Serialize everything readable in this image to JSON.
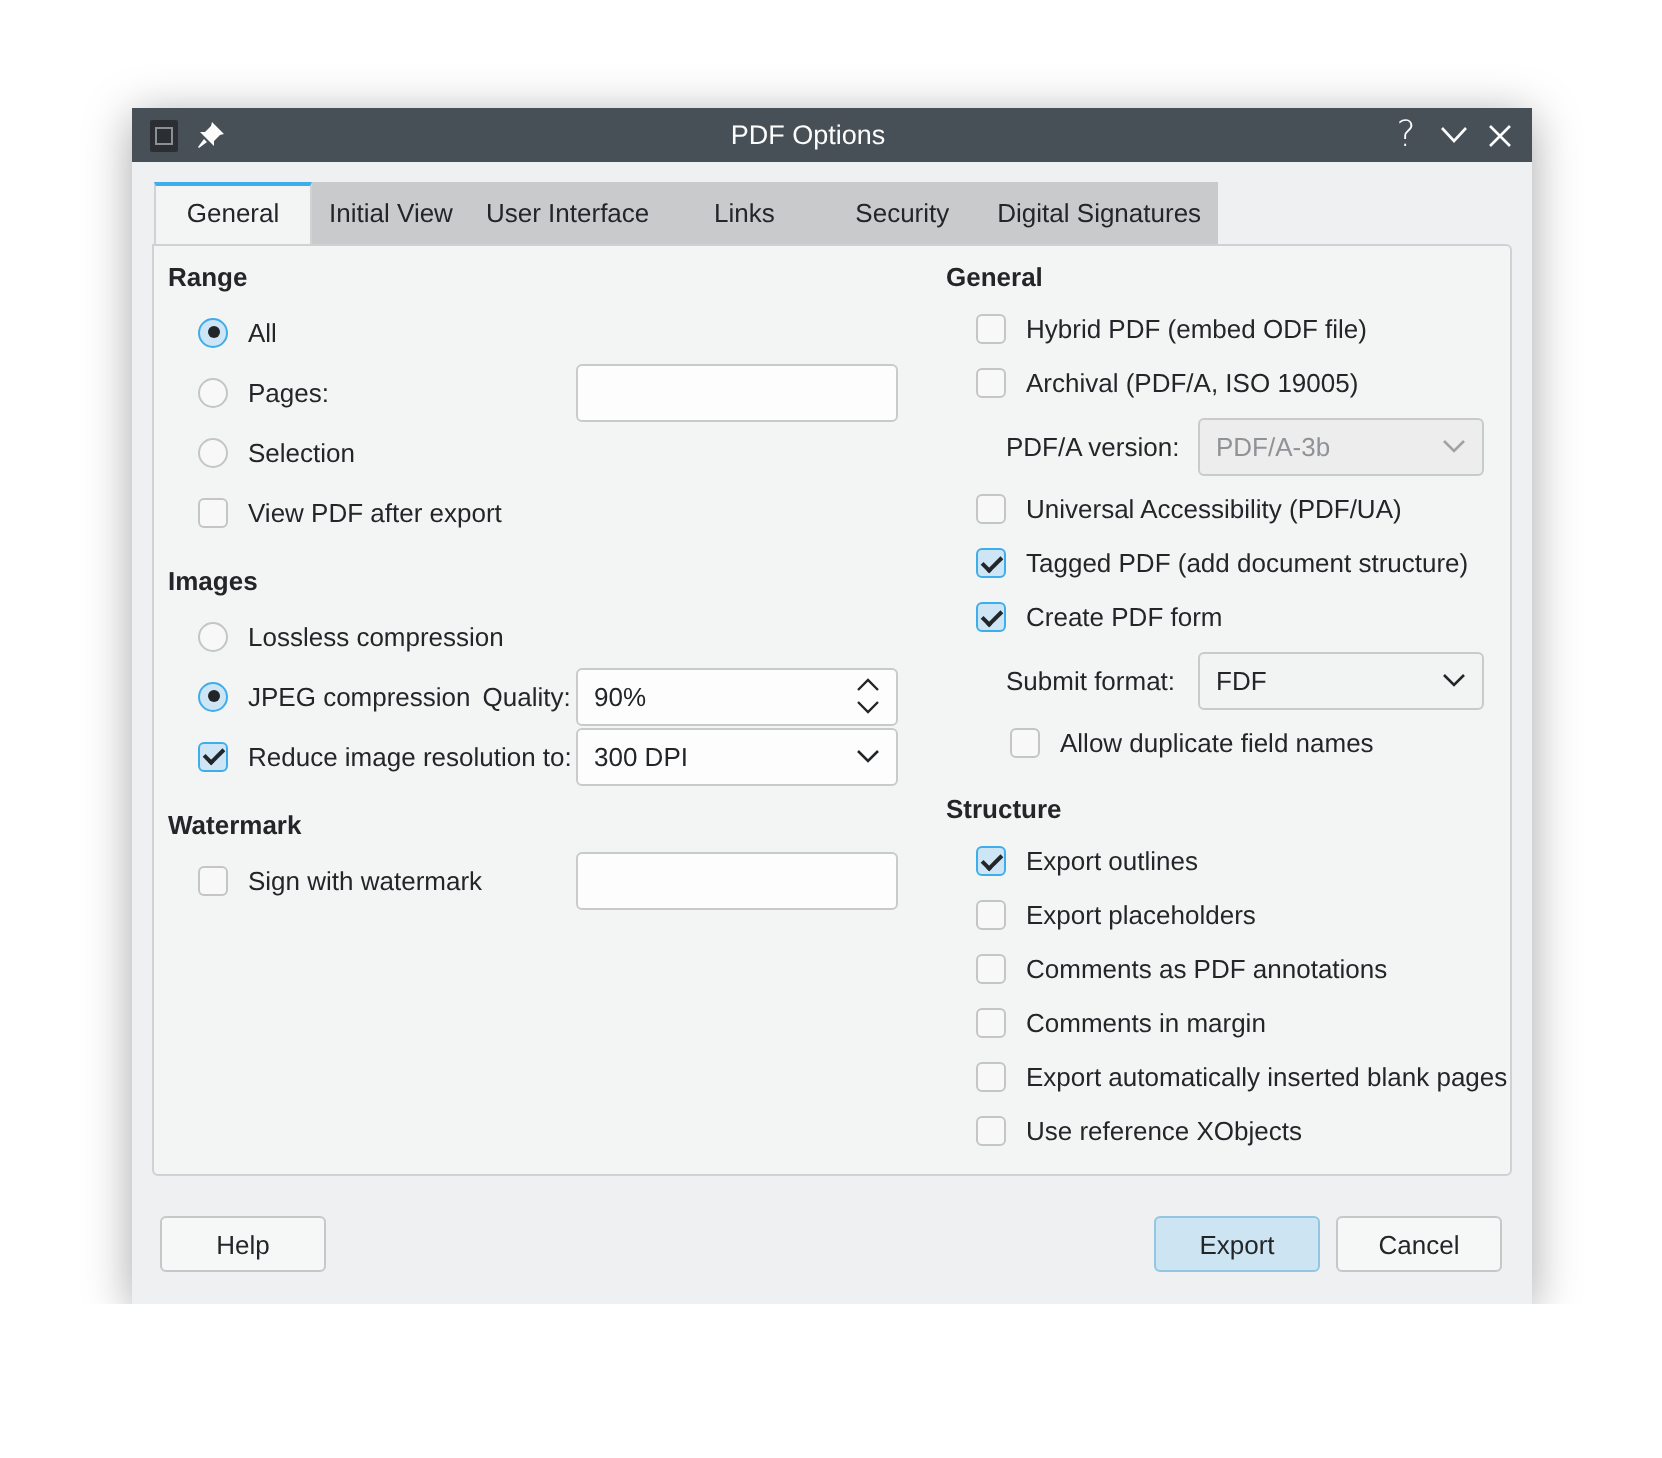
{
  "window": {
    "title": "PDF Options",
    "help_glyph": "?"
  },
  "tabs": [
    {
      "label": "General",
      "selected": true
    },
    {
      "label": "Initial View",
      "selected": false
    },
    {
      "label": "User Interface",
      "selected": false
    },
    {
      "label": "Links",
      "selected": false
    },
    {
      "label": "Security",
      "selected": false
    },
    {
      "label": "Digital Signatures",
      "selected": false
    }
  ],
  "left_sections": [
    {
      "title": "Range",
      "items": [
        {
          "kind": "radio",
          "label": "All",
          "selected": true
        },
        {
          "kind": "radio",
          "label": "Pages:",
          "selected": false,
          "field": {
            "kind": "text"
          }
        },
        {
          "kind": "radio",
          "label": "Selection",
          "selected": false
        },
        {
          "kind": "checkbox",
          "label": "View PDF after export",
          "checked": false
        }
      ]
    },
    {
      "title": "Images",
      "items": [
        {
          "kind": "radio",
          "label": "Lossless compression",
          "selected": false
        },
        {
          "kind": "radio",
          "label": "JPEG compression",
          "sub_label": "Quality:",
          "selected": true,
          "field": {
            "kind": "spin",
            "value": "90%"
          }
        },
        {
          "kind": "checkbox",
          "label": "Reduce image resolution to:",
          "checked": true,
          "field": {
            "kind": "select",
            "value": "300 DPI",
            "disabled": false
          }
        }
      ]
    },
    {
      "title": "Watermark",
      "items": [
        {
          "kind": "checkbox",
          "label": "Sign with watermark",
          "checked": false,
          "field": {
            "kind": "text"
          }
        }
      ]
    }
  ],
  "right_sections": [
    {
      "title": "General",
      "items": [
        {
          "kind": "checkbox",
          "label": "Hybrid PDF (embed ODF file)",
          "checked": false
        },
        {
          "kind": "checkbox",
          "label": "Archival (PDF/A, ISO 19005)",
          "checked": false,
          "children": [
            {
              "kind": "label",
              "label": "PDF/A version:",
              "field": {
                "kind": "select",
                "value": "PDF/A-3b",
                "disabled": true
              }
            }
          ]
        },
        {
          "kind": "checkbox",
          "label": "Universal Accessibility (PDF/UA)",
          "checked": false
        },
        {
          "kind": "checkbox",
          "label": "Tagged PDF (add document structure)",
          "checked": true
        },
        {
          "kind": "checkbox",
          "label": "Create PDF form",
          "checked": true,
          "children": [
            {
              "kind": "label",
              "label": "Submit format:",
              "field": {
                "kind": "select",
                "value": "FDF",
                "disabled": false
              }
            },
            {
              "kind": "checkbox",
              "label": "Allow duplicate field names",
              "checked": false
            }
          ]
        }
      ]
    },
    {
      "title": "Structure",
      "items": [
        {
          "kind": "checkbox",
          "label": "Export outlines",
          "checked": true
        },
        {
          "kind": "checkbox",
          "label": "Export placeholders",
          "checked": false
        },
        {
          "kind": "checkbox",
          "label": "Comments as PDF annotations",
          "checked": false
        },
        {
          "kind": "checkbox",
          "label": "Comments in margin",
          "checked": false
        },
        {
          "kind": "checkbox",
          "label": "Export automatically inserted blank pages",
          "checked": false
        },
        {
          "kind": "checkbox",
          "label": "Use reference XObjects",
          "checked": false
        }
      ]
    }
  ],
  "footer": {
    "left_buttons": [
      {
        "label": "Help",
        "default": false
      }
    ],
    "right_buttons": [
      {
        "label": "Export",
        "default": true
      },
      {
        "label": "Cancel",
        "default": false
      }
    ]
  }
}
